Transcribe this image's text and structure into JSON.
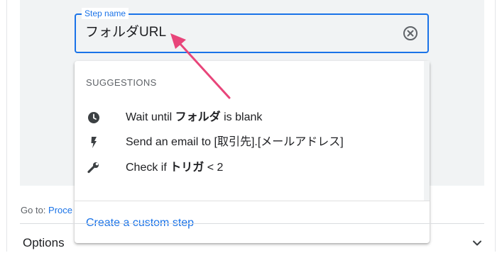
{
  "step_field": {
    "label": "Step name",
    "value": "フォルダURL",
    "clear_icon": "clear-circle-icon"
  },
  "suggestions": {
    "header": "SUGGESTIONS",
    "items": [
      {
        "icon": "clock-icon",
        "pre": "Wait until ",
        "bold": "フォルダ",
        "post": " is blank"
      },
      {
        "icon": "lightning-icon",
        "pre": "Send an email to [取引先].[メールアドレス]",
        "bold": "",
        "post": ""
      },
      {
        "icon": "wrench-icon",
        "pre": "Check if ",
        "bold": "トリガ",
        "post": " < 2"
      }
    ],
    "create_label": "Create a custom step"
  },
  "goto": {
    "label": "Go to: ",
    "link": "Proce"
  },
  "options": {
    "label": "Options",
    "chevron_icon": "chevron-down-icon"
  },
  "colors": {
    "accent": "#1a73e8",
    "annotation_arrow": "#e8457a",
    "panel_bg": "#f1f3f4"
  }
}
